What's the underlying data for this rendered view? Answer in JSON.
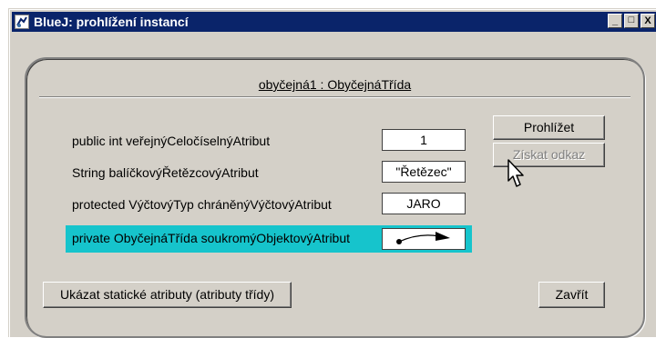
{
  "window": {
    "title": "BlueJ: prohlížení instancí",
    "controls": {
      "minimize": "_",
      "maximize": "□",
      "close": "X"
    }
  },
  "inspector": {
    "object_title": "obyčejná1 : ObyčejnáTřída",
    "fields": [
      {
        "label": "public int veřejnýCeločíselnýAtribut",
        "value": "1"
      },
      {
        "label": "String balíčkovýŘetězcovýAtribut",
        "value": "\"Řetězec\""
      },
      {
        "label": "protected VýčtovýTyp chráněnýVýčtovýAtribut",
        "value": "JARO"
      },
      {
        "label": "private ObyčejnáTřída soukromýObjektovýAtribut",
        "value": "object-reference-arrow-icon",
        "selected": true
      }
    ],
    "highlight_color": "#16c4cc"
  },
  "buttons": {
    "inspect": "Prohlížet",
    "get_reference": "Získat odkaz",
    "static_attributes": "Ukázat statické atributy (atributy třídy)",
    "close": "Zavřít"
  },
  "colors": {
    "titlebar": "#0a246a",
    "face": "#d4d0c8"
  }
}
